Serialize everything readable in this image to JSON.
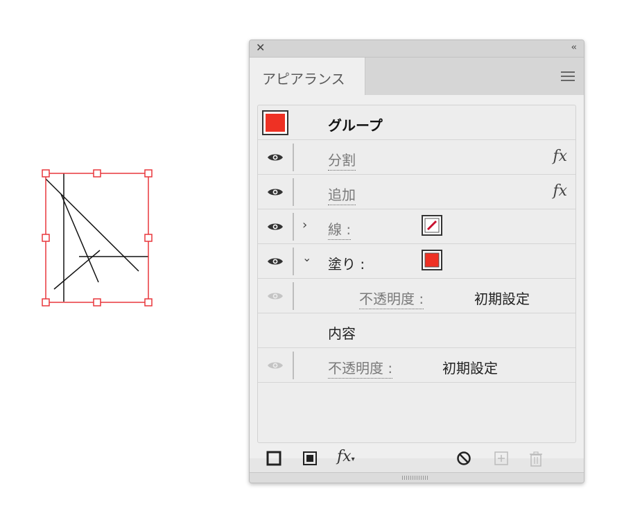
{
  "panel": {
    "close_glyph": "✕",
    "collapse_glyph": "‹‹",
    "tab_title": "アピアランス",
    "menu_icon": "hamburger-menu-icon"
  },
  "rows": {
    "group": {
      "label": "グループ",
      "swatch_color": "#ee3124"
    },
    "divide": {
      "label": "分割",
      "fx": "fx"
    },
    "add": {
      "label": "追加",
      "fx": "fx"
    },
    "stroke": {
      "label": "線 :",
      "chevron": "›",
      "swatch_color": "#c8102e"
    },
    "fill": {
      "label": "塗り :",
      "chevron": "⌄",
      "swatch_color": "#ee3124"
    },
    "fill_opacity": {
      "label": "不透明度 :",
      "value": "初期設定"
    },
    "contents": {
      "label": "内容"
    },
    "opacity": {
      "label": "不透明度 :",
      "value": "初期設定"
    }
  },
  "footer": {
    "fx_label": "fx",
    "icons": [
      "add-new-stroke-icon",
      "add-new-fill-icon",
      "add-new-effect-icon",
      "clear-appearance-icon",
      "duplicate-item-icon",
      "delete-item-icon"
    ]
  },
  "colors": {
    "selection": "#e8363b",
    "fill_red": "#ee3124",
    "stroke_red": "#c8102e"
  }
}
